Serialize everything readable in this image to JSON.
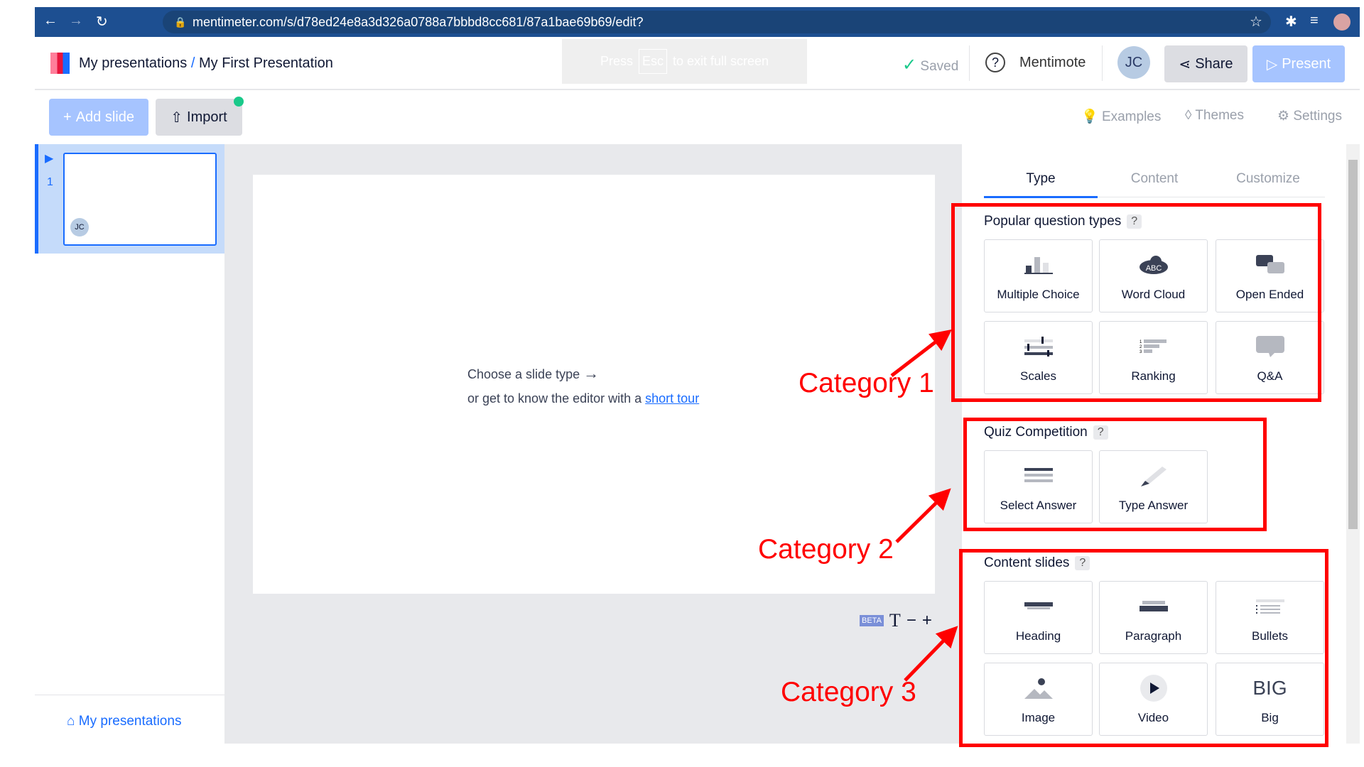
{
  "browser": {
    "url": "mentimeter.com/s/d78ed24e8a3d326a0788a7bbbd8cc681/87a1bae69b69/edit?"
  },
  "header": {
    "breadcrumb_root": "My presentations",
    "separator": "/",
    "title": "My First Presentation",
    "fullscreen_press": "Press",
    "fullscreen_key": "Esc",
    "fullscreen_rest": "to exit full screen",
    "saved": "Saved",
    "mentimote": "Mentimote",
    "avatar": "JC",
    "share": "Share",
    "present": "Present"
  },
  "toolbar": {
    "add_slide": "Add slide",
    "import": "Import",
    "examples": "Examples",
    "themes": "Themes",
    "settings": "Settings"
  },
  "sidebar": {
    "slide_number": "1",
    "thumb_avatar": "JC",
    "my_presentations": "My presentations"
  },
  "canvas": {
    "choose": "Choose a slide type",
    "tour_prefix": "or get to know the editor with a",
    "tour_link": "short tour",
    "beta": "BETA",
    "text_icon": "T",
    "minus": "−",
    "plus": "+"
  },
  "panel": {
    "tabs": [
      "Type",
      "Content",
      "Customize"
    ],
    "sections": [
      {
        "title": "Popular question types",
        "help": "?",
        "items": [
          "Multiple Choice",
          "Word Cloud",
          "Open Ended",
          "Scales",
          "Ranking",
          "Q&A"
        ]
      },
      {
        "title": "Quiz Competition",
        "help": "?",
        "items": [
          "Select Answer",
          "Type Answer"
        ]
      },
      {
        "title": "Content slides",
        "help": "?",
        "items": [
          "Heading",
          "Paragraph",
          "Bullets",
          "Image",
          "Video",
          "Big"
        ]
      }
    ],
    "big_icon_text": "BIG"
  },
  "annotations": [
    "Category 1",
    "Category 2",
    "Category 3"
  ],
  "colors": {
    "browser": "#1d4f91",
    "accent": "#196cff",
    "annotation": "#ff0000",
    "present": "#a6c4ff"
  }
}
